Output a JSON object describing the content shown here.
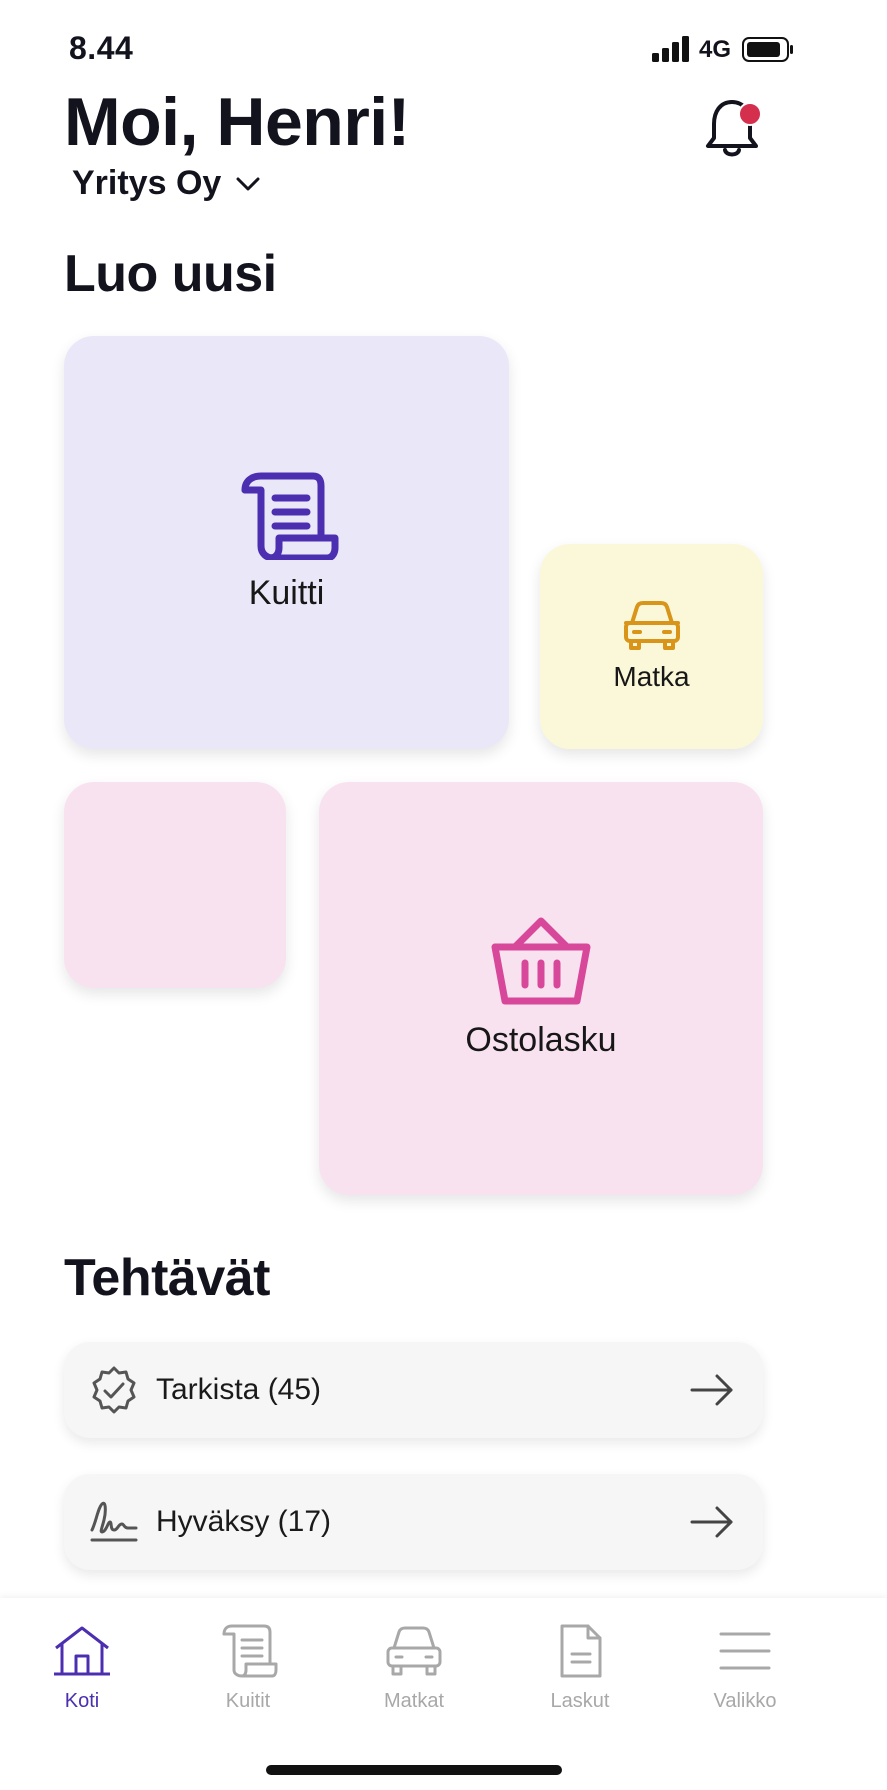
{
  "status_bar": {
    "time": "8.44",
    "network": "4G"
  },
  "header": {
    "greeting": "Moi, Henri!",
    "company": "Yritys Oy"
  },
  "create_section": {
    "title": "Luo uusi",
    "tiles": [
      {
        "label": "Kuitti",
        "icon": "receipt-scroll-icon",
        "color": "#4b2fb0",
        "bg": "#eae8f8"
      },
      {
        "label": "Matka",
        "icon": "car-icon",
        "color": "#d9951a",
        "bg": "#fbf8d9"
      },
      {
        "label": "Ostolasku",
        "icon": "basket-icon",
        "color": "#d8489a",
        "bg": "#f9e2f0"
      }
    ]
  },
  "tasks_section": {
    "title": "Tehtävät",
    "items": [
      {
        "label": "Tarkista (45)",
        "icon": "check-badge-icon"
      },
      {
        "label": "Hyväksy (17)",
        "icon": "signature-icon"
      }
    ]
  },
  "tabbar": {
    "tabs": [
      {
        "label": "Koti",
        "icon": "home-icon",
        "active": true
      },
      {
        "label": "Kuitit",
        "icon": "receipt-icon",
        "active": false
      },
      {
        "label": "Matkat",
        "icon": "car-icon",
        "active": false
      },
      {
        "label": "Laskut",
        "icon": "document-icon",
        "active": false
      },
      {
        "label": "Valikko",
        "icon": "menu-icon",
        "active": false
      }
    ]
  },
  "colors": {
    "accent": "#4b2fb0",
    "notification": "#d42f4d",
    "inactive": "#a8a8a8"
  }
}
